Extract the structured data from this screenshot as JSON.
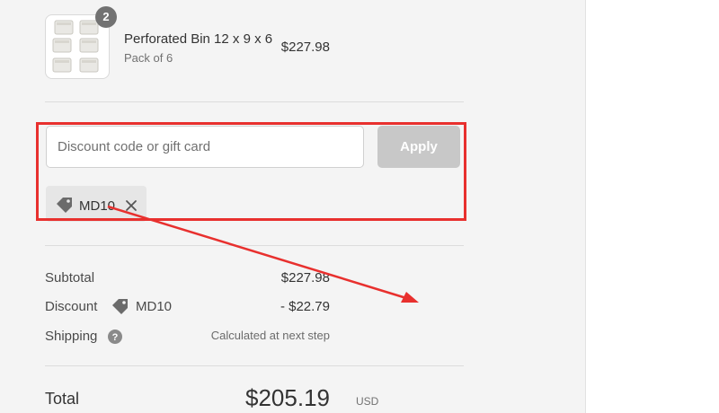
{
  "line_item": {
    "quantity": "2",
    "name": "Perforated Bin 12 x 9 x 6",
    "variant": "Pack of 6",
    "price": "$227.98",
    "image_icon": "storage-bins-thumbnail"
  },
  "discount_form": {
    "placeholder": "Discount code or gift card",
    "value": "",
    "apply_label": "Apply",
    "applied_code": "MD10",
    "tag_icon": "tag-icon",
    "remove_icon": "close-icon"
  },
  "summary": {
    "subtotal_label": "Subtotal",
    "subtotal_value": "$227.98",
    "discount_label": "Discount",
    "discount_code": "MD10",
    "discount_value": "- $22.79",
    "shipping_label": "Shipping",
    "shipping_help_icon": "question-circle-icon",
    "shipping_value": "Calculated at next step",
    "total_label": "Total",
    "total_currency": "USD",
    "total_value": "$205.19"
  },
  "annotation": {
    "highlight_color": "#e8302e",
    "arrow_color": "#e8302e"
  },
  "colors": {
    "panel_bg": "#f4f4f4",
    "apply_disabled": "#c8c8c8",
    "badge_bg": "#727272",
    "code_tag_bg": "#e6e6e6"
  }
}
